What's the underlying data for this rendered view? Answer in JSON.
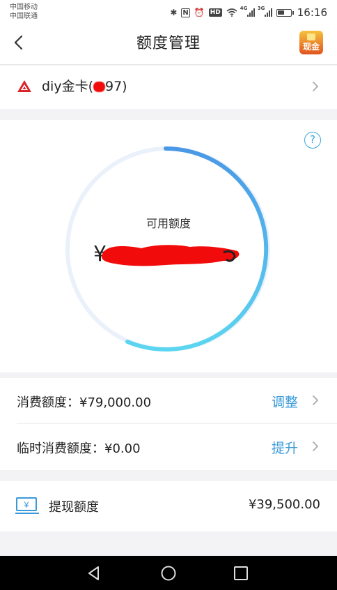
{
  "status_bar": {
    "carrier_1": "中国移动",
    "carrier_2": "中国联通",
    "bluetooth": "✱",
    "nfc": "N",
    "alarm": "⏰",
    "hd": "HD",
    "net_4g": "4G",
    "net_3g": "3G",
    "time": "16:16"
  },
  "header": {
    "title": "额度管理",
    "cash_badge": "现金"
  },
  "card": {
    "label": "diy金卡(",
    "suffix": "97)"
  },
  "credit": {
    "available_label": "可用额度",
    "currency": "¥"
  },
  "limits": {
    "consumption_label": "消费额度：",
    "consumption_value": "¥79,000.00",
    "consumption_action": "调整",
    "temporary_label": "临时消费额度：",
    "temporary_value": "¥0.00",
    "temporary_action": "提升"
  },
  "withdraw": {
    "label": "提现额度",
    "amount": "¥39,500.00",
    "icon_glyph": "¥"
  },
  "colors": {
    "accent": "#3a9ad9",
    "ring_start": "#4a98e6",
    "ring_end": "#5cd6f0",
    "ring_track": "#eaf1fb",
    "redact": "#f20b0b",
    "brand_red": "#d8252a"
  }
}
